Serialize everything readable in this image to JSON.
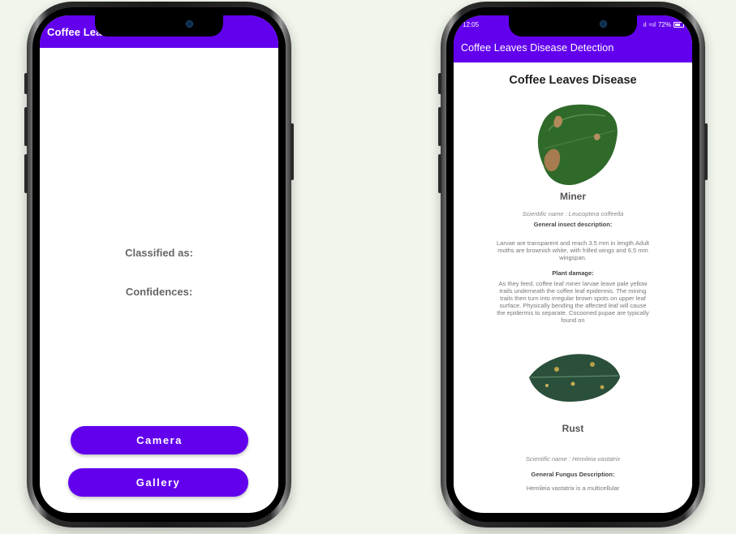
{
  "left_phone": {
    "app_title": "Coffee Leaves Disease Detection",
    "classified_label": "Classified as:",
    "confidences_label": "Confidences:",
    "camera_button": "Camera",
    "gallery_button": "Gallery"
  },
  "right_phone": {
    "status": {
      "time": "12:05",
      "signal": "ıl",
      "network": "≈ıl",
      "battery": "72%"
    },
    "app_title": "Coffee Leaves Disease Detection",
    "page_heading": "Coffee Leaves Disease",
    "diseases": [
      {
        "name": "Miner",
        "scientific": "Scientific name : Leucoptera coffeella",
        "section1_title": "General insect description:",
        "section1_text": "Larvae are transparent and reach 3.5 mm in length.Adult moths are brownish white, with frilled wings and 6.5 mm wingspan.",
        "section2_title": "Plant damage:",
        "section2_text": "As they feed, coffee leaf miner larvae leave pale yellow trails underneath the coffee leaf epidermis. The mining trails then turn into irregular brown spots on upper leaf surface. Physically bending the affected leaf will cause the epidermis to separate. Cocooned pupae are typically found on"
      },
      {
        "name": "Rust",
        "scientific": "Scientific name : Hemileia vastatrix",
        "section1_title": "General Fungus Description:",
        "section1_text": "Hemileia vastatrix is a multicellular"
      }
    ]
  },
  "colors": {
    "primary": "#6200ee",
    "background": "#f1f6ec"
  }
}
